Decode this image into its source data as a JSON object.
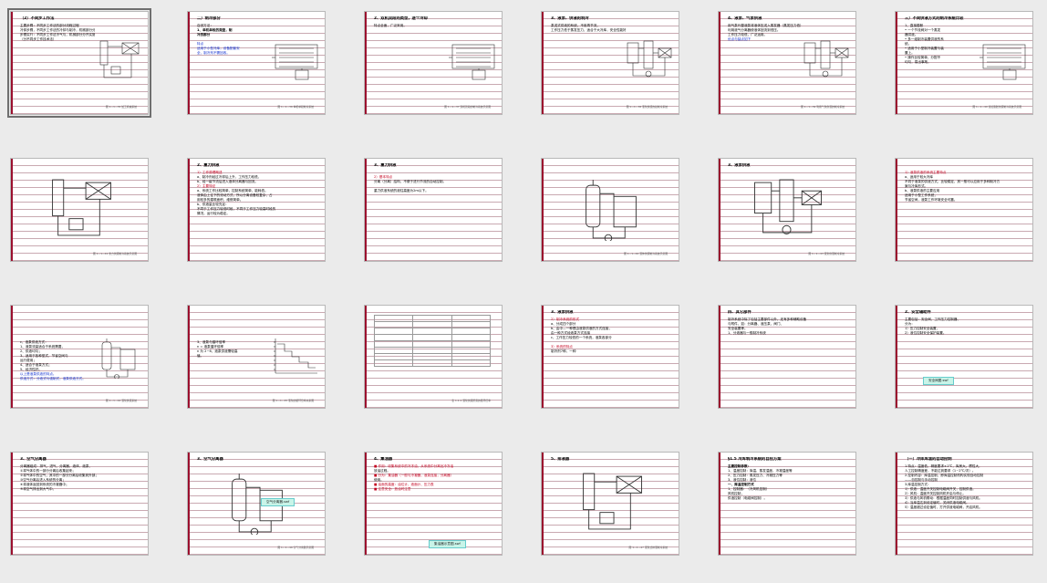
{
  "window": {
    "title": "幻灯片浏览"
  },
  "slides": [
    {
      "id": 1,
      "selected": true,
      "title": "（2）不同步工作法",
      "lines": [
        {
          "t": "主要步骤：不同步工作法的部分流程过程"
        },
        {
          "t": "冷却步骤，不同步工作法的冷却与制冷，机械部分分开"
        },
        {
          "t": "步骤实行：不同步工作法冷气与，机械部分分开实施。"
        },
        {
          "t": "（分不同步工作技术法）"
        }
      ],
      "diagram": "process",
      "caption": "图 1—1—35  加工机械系统"
    },
    {
      "id": 2,
      "title": "二）制冷部分",
      "lines": [
        {
          "t": "自然方法："
        },
        {
          "t": "1、单机单段的类型，制",
          "b": true
        },
        {
          "t": "冷的部分",
          "b": true
        },
        {
          "t": ""
        },
        {
          "t": "特点",
          "c": "blue"
        },
        {
          "t": "适用于小型冷库，设备配套安",
          "c": "blue"
        },
        {
          "t": "全，制冷剂不需回收。",
          "c": "blue"
        }
      ],
      "diagram": "coil",
      "caption": "图 1—1—36  单机单段制冷系统"
    },
    {
      "id": 3,
      "title": "2、双机双段的类型，逐个冷却",
      "lines": [
        {
          "t": "特点全面，广泛采用。"
        }
      ],
      "diagram": "coil",
      "caption": "图 1—1—37  双机双段的制冷系统示意图"
    },
    {
      "id": 4,
      "title": "3、液泵、供液的制冷",
      "lines": [
        {
          "t": "泵送式供液的系统，不用再节流，"
        },
        {
          "t": "工作压力低于蒸发压力，适合于大冷库，安全性能好、运行节能。"
        }
      ],
      "diagram": "pump",
      "caption": "图 1—1—38  液泵供液的氨制冷系统"
    },
    {
      "id": 5,
      "title": "4、液泵、气泵供液",
      "lines": [
        {
          "t": "用气泵代替液泵将液体压送入蒸发器（蒸发压力低），"
        },
        {
          "t": "利用液气分离器使液体回流到低压。"
        },
        {
          "t": "工作压力较低，广泛运用。"
        },
        {
          "t": "优点与缺点如下",
          "c": "blue"
        }
      ],
      "diagram": "pump",
      "caption": "图 1—1—39  利用气泵供液的制冷系统"
    },
    {
      "id": 6,
      "title": "三）不同供液方式的制冷系统比较",
      "lines": [
        {
          "t": "1、直接膨胀"
        },
        {
          "t": "• 一个节流阀对一个蒸发"
        },
        {
          "t": "   器供液。"
        },
        {
          "t": "• 多一组制冷装置供液的系"
        },
        {
          "t": "   统。"
        },
        {
          "t": "• 适用于小型制冷装置与装"
        },
        {
          "t": "   置上。"
        },
        {
          "t": "• 操作比较简单，分配不"
        },
        {
          "t": "   均匀，易出事故。"
        }
      ],
      "diagram": "coil",
      "caption": "图 1—1—40  直接膨胀供液制冷系统示意图"
    },
    {
      "id": 7,
      "title": "",
      "lines": [],
      "diagram": "process",
      "caption": "图 1—1—41  重力供液制冷系统示意图"
    },
    {
      "id": 8,
      "title": "2、重力供液",
      "lines": [
        {
          "t": "1）工作原理概述",
          "c": "red"
        },
        {
          "t": "a、制冷剂经过冷却后上升，工作压力较低，"
        },
        {
          "t": "b、经一级节流后进入液体分离器与回流。"
        },
        {
          "t": "2）主要特征",
          "c": "red"
        },
        {
          "t": "a、系统工作比较简单，控制系统简单，能耗低。"
        },
        {
          "t": "液体由上往下的流动方式，所以分离设备较复杂，占"
        },
        {
          "t": "用较多的建筑面积，维修简单。"
        },
        {
          "t": "b、供液量比较充足："
        },
        {
          "t": "不同于工作压力较低时段，不同于工作压力较高时段的"
        },
        {
          "t": "情况，运行较为稳定。"
        }
      ]
    },
    {
      "id": 9,
      "title": "3、重力供液",
      "lines": [
        {
          "t": ""
        },
        {
          "t": "2）基本特点",
          "c": "red"
        },
        {
          "t": "分离（分离）结构，不便于进行节流的自动控制。"
        },
        {
          "t": ""
        },
        {
          "t": "重力供液系统的液柱高度为2m以下。"
        }
      ]
    },
    {
      "id": 10,
      "title": "",
      "lines": [],
      "diagram": "tank",
      "caption": "图 1—1—42  液体供液制冷系统示意图"
    },
    {
      "id": 11,
      "title": "3、液泵供液",
      "lines": [],
      "diagram": "pump",
      "caption": "图 1—1—43  液泵供液制冷系统"
    },
    {
      "id": 12,
      "title": "",
      "lines": [
        {
          "t": "1）液泵供液的系统主要特点",
          "c": "red"
        },
        {
          "t": "a、适用于较大冷库"
        },
        {
          "t": "不同于液泵的供液方式，比较稳定，其一般可以应用于多种制冷方"
        },
        {
          "t": "案与冷库形式。"
        },
        {
          "t": "b、液泵供液的主要应用"
        },
        {
          "t": "适用于小型工作系统，"
        },
        {
          "t": "节省空间，液泵工作环境安全可靠。"
        }
      ]
    },
    {
      "id": 13,
      "title": "",
      "lines": [
        {
          "t": ""
        },
        {
          "t": ""
        },
        {
          "t": ""
        },
        {
          "t": ""
        },
        {
          "t": ""
        },
        {
          "t": "c、液泵供液方式："
        },
        {
          "t": "1、液泵流量适合于系统需要，"
        },
        {
          "t": "2、供液均匀；"
        },
        {
          "t": "3、适用于各种型式，节省空间与"
        },
        {
          "t": "   运行费用；"
        },
        {
          "t": "4、适合于液泵方式；"
        },
        {
          "t": "5、经济性好。"
        },
        {
          "t": "以上是液泵供液的特点。",
          "c": "blue"
        },
        {
          "t": "供液方式：分液式与强制式，液泵供液方式。",
          "c": "blue"
        }
      ],
      "diagram": "tank",
      "caption": "图 1—1—44  液泵供液系统"
    },
    {
      "id": 14,
      "title": "",
      "lines": [
        {
          "t": ""
        },
        {
          "t": ""
        },
        {
          "t": ""
        },
        {
          "t": ""
        },
        {
          "t": ""
        },
        {
          "t": "3、液泵与循环倍率"
        },
        {
          "t": "n = 液泵循环倍率"
        },
        {
          "t": "n 为 2~6，液泵供液需较高"
        },
        {
          "t": "值。"
        }
      ],
      "diagram": "curve",
      "caption": "图 1—1—45  液泵的循环倍率关系图"
    },
    {
      "id": 15,
      "title": "",
      "lines": [],
      "diagram": "table",
      "caption": "表 1-1-1 液泵供液所需的循环倍率"
    },
    {
      "id": 16,
      "title": "3、液泵供液",
      "lines": [
        {
          "t": "2）制冷系统的形式",
          "c": "red"
        },
        {
          "t": "a、分成四个部分"
        },
        {
          "t": "b、由中—一种是由液泵供液的方式连接，"
        },
        {
          "t": "   由一种方式经液泵方式连接"
        },
        {
          "t": "c、工作压力较低的一个系统，液泵各部分"
        },
        {
          "t": ""
        },
        {
          "t": "3）系统的特点",
          "c": "red"
        },
        {
          "t": "制冷剂7种，一种"
        }
      ]
    },
    {
      "id": 17,
      "title": "四、其它部件",
      "lines": [
        {
          "t": "制冷系统中除了包括主要部件以外，还有多种辅助设备"
        },
        {
          "t": "与附件，如：分离器、液压泵、阀门、"
        },
        {
          "t": "安全装置等。"
        },
        {
          "t": "1、分液器与一般制冷系统"
        }
      ]
    },
    {
      "id": 18,
      "title": "2、安全辅助件",
      "lines": [
        {
          "t": "主要包括：安全阀、工作压力控制器、"
        },
        {
          "t": "分为："
        },
        {
          "t": "1）压力控制安全装置，"
        },
        {
          "t": "2）液位控制安全保护装置。"
        }
      ],
      "badge": "安全阀图.swf"
    },
    {
      "id": 19,
      "title": "3、空气分离器",
      "lines": [
        {
          "t": "分离器组成：排气、进气、分离器、液体、液泵、"
        },
        {
          "t": "①将气体中的一部分分离后收集起来；"
        },
        {
          "t": "②将气体中的空气，其中的一部分分离后收集到外部；"
        },
        {
          "t": "③空气分离后进入系统的分离；"
        },
        {
          "t": "④将液体返回到系统的冷凝器中；"
        },
        {
          "t": "⑤将空气排出到大气中。"
        }
      ]
    },
    {
      "id": 20,
      "title": "3、空气分离器",
      "lines": [],
      "diagram": "tank",
      "caption": "图 1—1—46  空气分离器示意图",
      "badge": "空气分离器.swf"
    },
    {
      "id": 21,
      "title": "4、集油器",
      "lines": [
        {
          "t": "■ 作用：收集系统中的冷冻油，从系统中分离出冷冻油",
          "c": "red",
          "dot": true
        },
        {
          "t": "   放油过程。"
        },
        {
          "t": "■ 分为：集油器（一般与冷凝器，液泵连接，分离器）",
          "c": "red",
          "dot": true
        },
        {
          "t": "   使用。"
        },
        {
          "t": "■ 油面的高度：油位计、液面计、压力表",
          "c": "red",
          "dot": true
        },
        {
          "t": "■ 注意安全：放油时注意",
          "c": "red",
          "dot": true
        }
      ],
      "badge": "集油器示意图.swf"
    },
    {
      "id": 22,
      "title": "5、排液器",
      "lines": [],
      "diagram": "process",
      "caption": "图 1—1—47  液泵式排液制冷系统"
    },
    {
      "id": 23,
      "title": "§1.5 冷库制冷系统的自控方案",
      "lines": [
        {
          "t": "主要控制参数：",
          "b": true
        },
        {
          "t": "1、温度控制：库温、蒸发温度、冷凝温度等"
        },
        {
          "t": "2、压力控制：蒸发压力、冷凝压力等"
        },
        {
          "t": "3、液位控制：液位"
        },
        {
          "t": "一、库温控制方式",
          "b": true
        },
        {
          "t": "1、控制器：（冷风机控制）"
        },
        {
          "t": "   风机控制，"
        },
        {
          "t": "   供液控制（电磁阀控制）。"
        }
      ]
    },
    {
      "id": 24,
      "title": "（一）冷库库温的自动控制",
      "lines": [
        {
          "t": "1.特点：温度低、精度要求±1℃，库房大，惯性大，"
        },
        {
          "t": "  人工控制精度差，不能达到要求（1~2℃/次）。"
        },
        {
          "t": "2.控制内容：库温控制，即库温控制机构实现自动控制"
        },
        {
          "t": "  ——自控制与手动控制"
        },
        {
          "t": "3.库温控制方式："
        },
        {
          "t": "1）供液：温度开关控制电磁阀开关，控制供液。"
        },
        {
          "t": "2）风机：温度开关控制风机开启与停止。"
        },
        {
          "t": "3）供液与风机联动：根据温度同时控制供液与风机。"
        },
        {
          "t": "4）当库温达到设定值时，关闭供液电磁阀。"
        },
        {
          "t": "5）温度超过设定值时，打开供液电磁阀，开启风机。"
        }
      ]
    }
  ]
}
